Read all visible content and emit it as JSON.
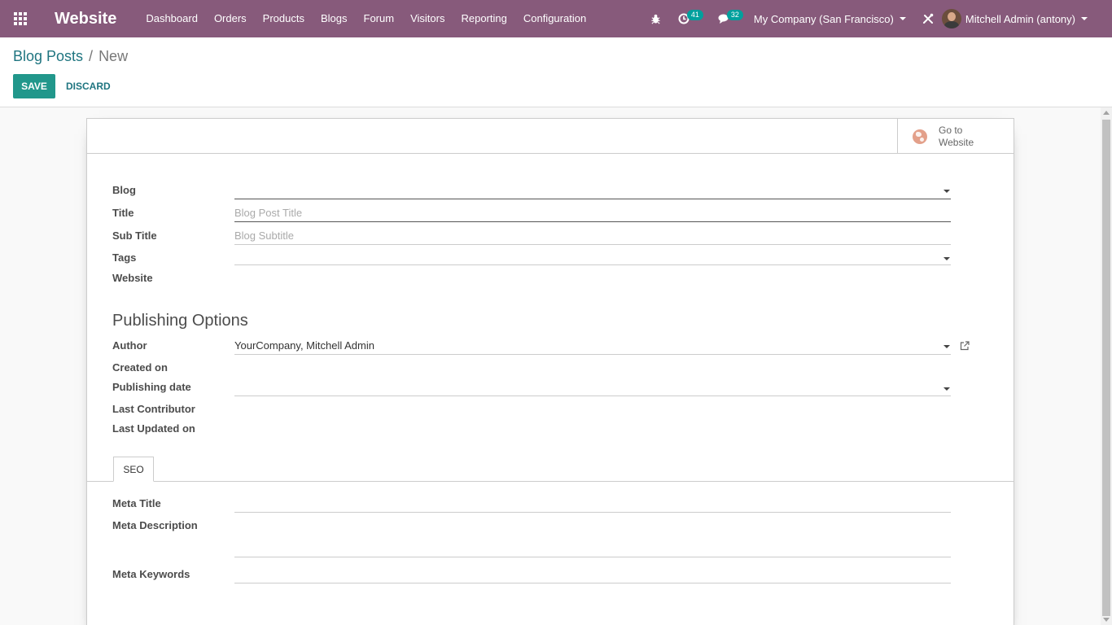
{
  "navbar": {
    "brand": "Website",
    "menu": [
      "Dashboard",
      "Orders",
      "Products",
      "Blogs",
      "Forum",
      "Visitors",
      "Reporting",
      "Configuration"
    ],
    "activities_count": "41",
    "messages_count": "32",
    "company": "My Company (San Francisco)",
    "user": "Mitchell Admin (antony)",
    "accent_color": "#875a7b",
    "badge_color": "#00a09d"
  },
  "breadcrumb": {
    "parent": "Blog Posts",
    "separator": "/",
    "current": "New"
  },
  "buttons": {
    "save": "SAVE",
    "discard": "DISCARD"
  },
  "smart_button": {
    "line1": "Go to",
    "line2": "Website",
    "icon": "globe-icon"
  },
  "form": {
    "blog_label": "Blog",
    "title_label": "Title",
    "title_placeholder": "Blog Post Title",
    "subtitle_label": "Sub Title",
    "subtitle_placeholder": "Blog Subtitle",
    "tags_label": "Tags",
    "website_label": "Website",
    "publishing_title": "Publishing Options",
    "author_label": "Author",
    "author_value": "YourCompany, Mitchell Admin",
    "created_on_label": "Created on",
    "publishing_date_label": "Publishing date",
    "last_contributor_label": "Last Contributor",
    "last_updated_label": "Last Updated on"
  },
  "tabs": [
    "SEO"
  ],
  "seo": {
    "meta_title_label": "Meta Title",
    "meta_description_label": "Meta Description",
    "meta_keywords_label": "Meta Keywords"
  }
}
